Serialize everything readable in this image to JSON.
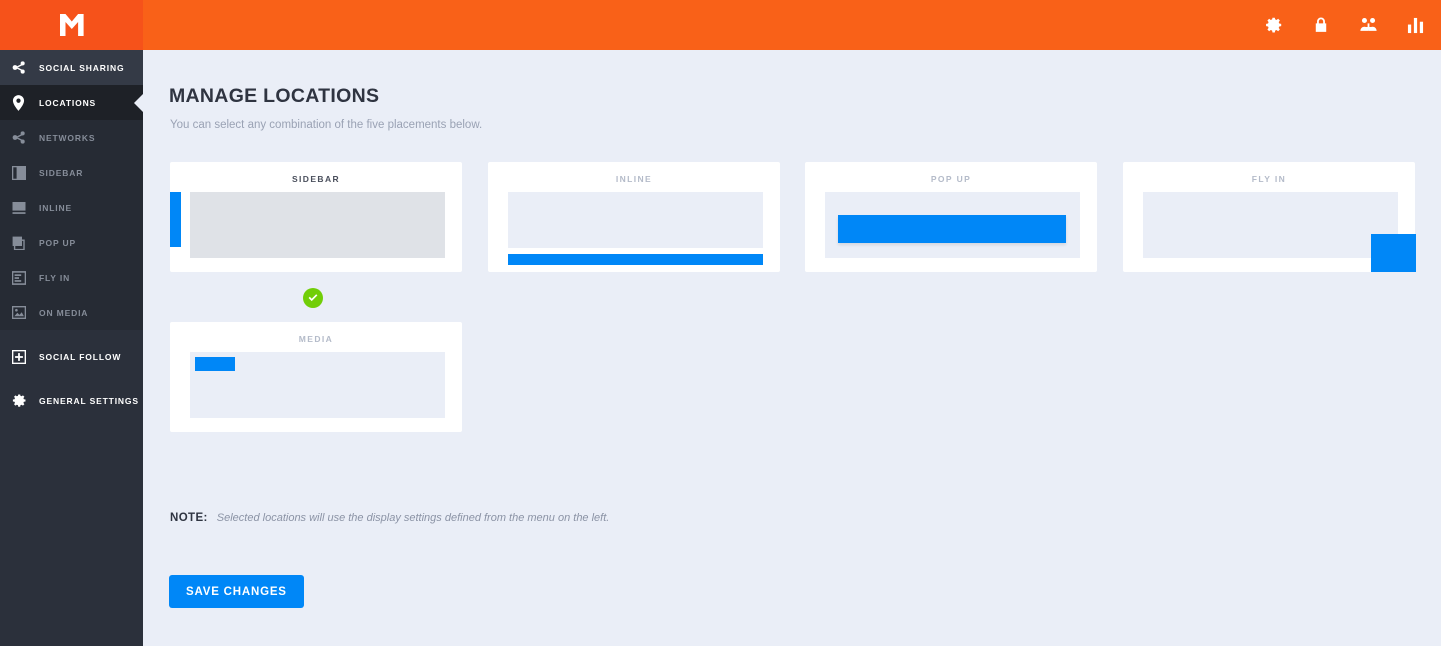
{
  "topbar": {
    "logo_alt": "Monarch logo M",
    "icons": [
      {
        "name": "gear-icon",
        "label": "Settings"
      },
      {
        "name": "lock-icon",
        "label": "Security"
      },
      {
        "name": "users-icon",
        "label": "Users"
      },
      {
        "name": "chart-icon",
        "label": "Analytics"
      }
    ]
  },
  "sidebar": {
    "items": [
      {
        "label": "SOCIAL SHARING",
        "icon": "share-icon",
        "type": "group",
        "active": false
      },
      {
        "label": "LOCATIONS",
        "icon": "map-pin-icon",
        "type": "active",
        "active": true
      },
      {
        "label": "NETWORKS",
        "icon": "share-icon",
        "type": "sub",
        "active": false
      },
      {
        "label": "SIDEBAR",
        "icon": "sidebar-layout-icon",
        "type": "sub",
        "active": false
      },
      {
        "label": "INLINE",
        "icon": "inline-layout-icon",
        "type": "sub",
        "active": false
      },
      {
        "label": "POP UP",
        "icon": "popup-layout-icon",
        "type": "sub",
        "active": false
      },
      {
        "label": "FLY IN",
        "icon": "flyin-layout-icon",
        "type": "sub",
        "active": false
      },
      {
        "label": "ON MEDIA",
        "icon": "media-image-icon",
        "type": "sub",
        "active": false
      },
      {
        "label": "SOCIAL FOLLOW",
        "icon": "plus-box-icon",
        "type": "group",
        "active": false
      },
      {
        "label": "GENERAL SETTINGS",
        "icon": "gear-icon",
        "type": "group",
        "active": false
      }
    ]
  },
  "main": {
    "title": "MANAGE LOCATIONS",
    "subtitle": "You can select any combination of the five placements below.",
    "cards": [
      {
        "label": "SIDEBAR",
        "selected": true
      },
      {
        "label": "INLINE",
        "selected": false
      },
      {
        "label": "POP UP",
        "selected": false
      },
      {
        "label": "FLY IN",
        "selected": false
      },
      {
        "label": "MEDIA",
        "selected": false
      }
    ],
    "note_label": "NOTE:",
    "note_text": "Selected locations will use the display settings defined from the menu on the left.",
    "save_label": "SAVE CHANGES"
  },
  "colors": {
    "brand_orange": "#f6521a",
    "topbar_orange": "#f96118",
    "accent_blue": "#0087f7",
    "success_green": "#71ce08",
    "sidebar_dark": "#2b303b",
    "sidebar_active": "#1e2127",
    "page_bg": "#eaeef7"
  }
}
